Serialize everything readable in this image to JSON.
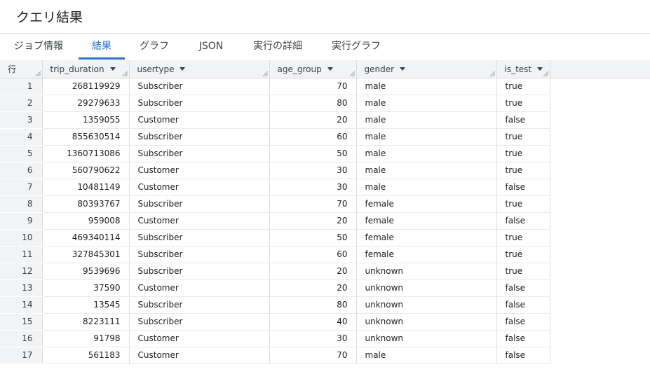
{
  "page": {
    "title": "クエリ結果"
  },
  "tabs": [
    {
      "label": "ジョブ情報"
    },
    {
      "label": "結果",
      "active": true
    },
    {
      "label": "グラフ"
    },
    {
      "label": "JSON"
    },
    {
      "label": "実行の詳細"
    },
    {
      "label": "実行グラフ"
    }
  ],
  "table": {
    "row_header": "行",
    "columns": [
      {
        "label": "trip_duration"
      },
      {
        "label": "usertype"
      },
      {
        "label": "age_group"
      },
      {
        "label": "gender"
      },
      {
        "label": "is_test"
      }
    ],
    "rows": [
      {
        "n": "1",
        "trip_duration": "268119929",
        "usertype": "Subscriber",
        "age_group": "70",
        "gender": "male",
        "is_test": "true"
      },
      {
        "n": "2",
        "trip_duration": "29279633",
        "usertype": "Subscriber",
        "age_group": "80",
        "gender": "male",
        "is_test": "true"
      },
      {
        "n": "3",
        "trip_duration": "1359055",
        "usertype": "Customer",
        "age_group": "20",
        "gender": "male",
        "is_test": "false"
      },
      {
        "n": "4",
        "trip_duration": "855630514",
        "usertype": "Subscriber",
        "age_group": "60",
        "gender": "male",
        "is_test": "true"
      },
      {
        "n": "5",
        "trip_duration": "1360713086",
        "usertype": "Subscriber",
        "age_group": "50",
        "gender": "male",
        "is_test": "true"
      },
      {
        "n": "6",
        "trip_duration": "560790622",
        "usertype": "Customer",
        "age_group": "30",
        "gender": "male",
        "is_test": "true"
      },
      {
        "n": "7",
        "trip_duration": "10481149",
        "usertype": "Customer",
        "age_group": "30",
        "gender": "male",
        "is_test": "false"
      },
      {
        "n": "8",
        "trip_duration": "80393767",
        "usertype": "Subscriber",
        "age_group": "70",
        "gender": "female",
        "is_test": "true"
      },
      {
        "n": "9",
        "trip_duration": "959008",
        "usertype": "Customer",
        "age_group": "20",
        "gender": "female",
        "is_test": "false"
      },
      {
        "n": "10",
        "trip_duration": "469340114",
        "usertype": "Subscriber",
        "age_group": "50",
        "gender": "female",
        "is_test": "true"
      },
      {
        "n": "11",
        "trip_duration": "327845301",
        "usertype": "Subscriber",
        "age_group": "60",
        "gender": "female",
        "is_test": "true"
      },
      {
        "n": "12",
        "trip_duration": "9539696",
        "usertype": "Subscriber",
        "age_group": "20",
        "gender": "unknown",
        "is_test": "true"
      },
      {
        "n": "13",
        "trip_duration": "37590",
        "usertype": "Customer",
        "age_group": "20",
        "gender": "unknown",
        "is_test": "false"
      },
      {
        "n": "14",
        "trip_duration": "13545",
        "usertype": "Subscriber",
        "age_group": "80",
        "gender": "unknown",
        "is_test": "false"
      },
      {
        "n": "15",
        "trip_duration": "8223111",
        "usertype": "Subscriber",
        "age_group": "40",
        "gender": "unknown",
        "is_test": "false"
      },
      {
        "n": "16",
        "trip_duration": "91798",
        "usertype": "Customer",
        "age_group": "30",
        "gender": "unknown",
        "is_test": "false"
      },
      {
        "n": "17",
        "trip_duration": "561183",
        "usertype": "Customer",
        "age_group": "70",
        "gender": "male",
        "is_test": "false"
      }
    ]
  }
}
